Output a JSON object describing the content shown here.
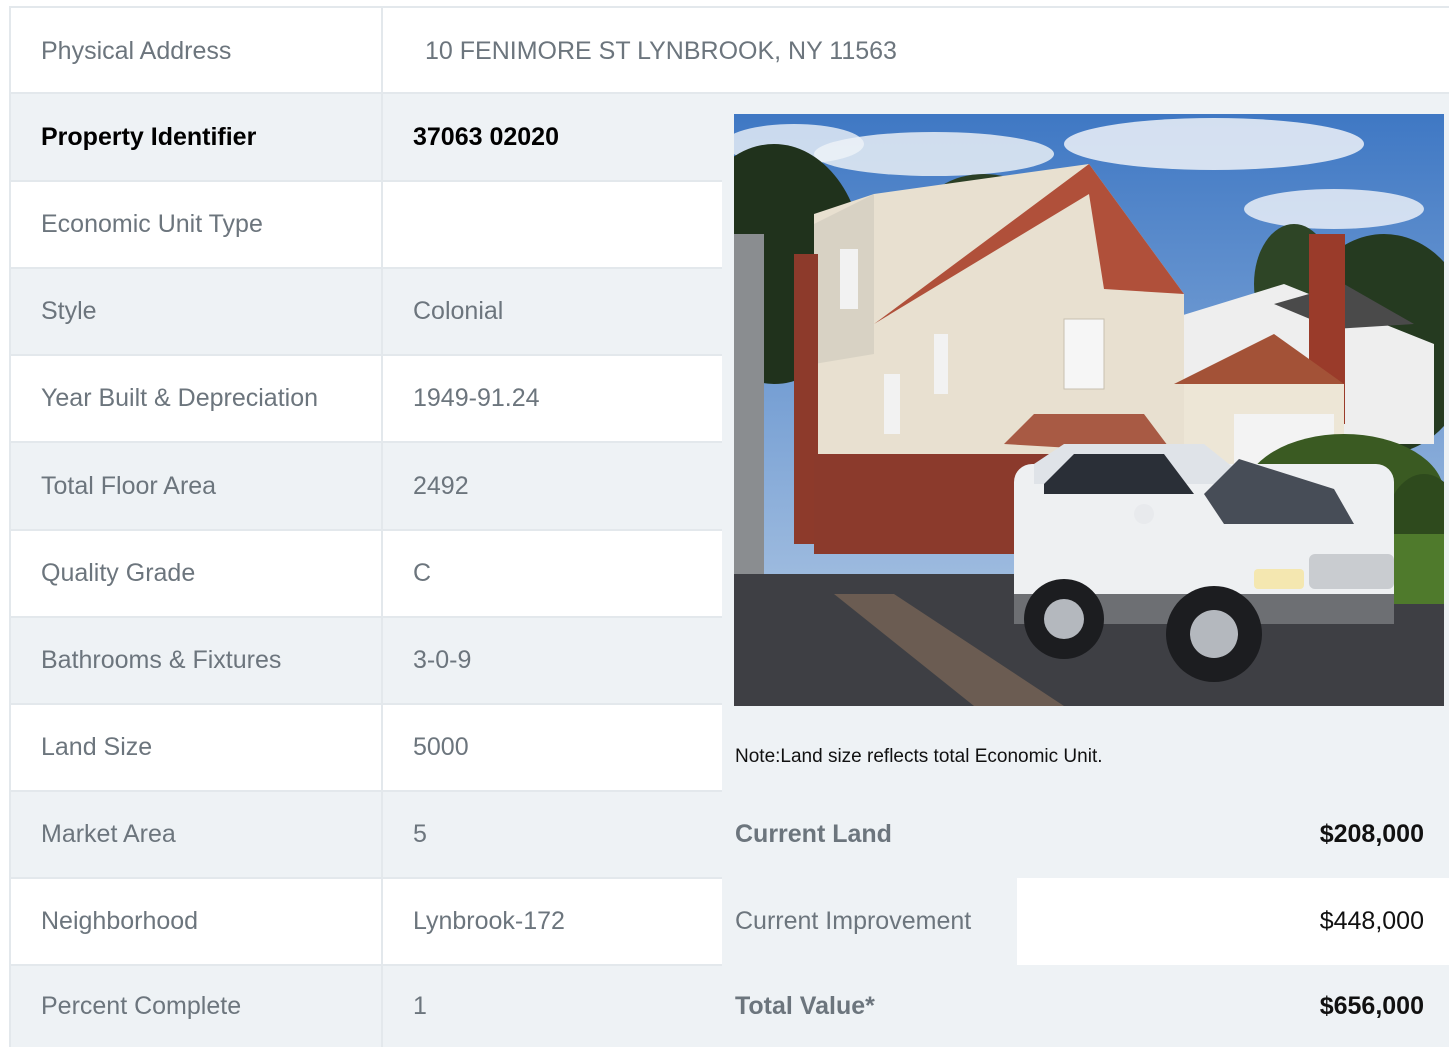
{
  "address": {
    "label": "Physical Address",
    "value": "10  FENIMORE ST  LYNBROOK, NY  11563"
  },
  "rows": [
    {
      "label": "Property Identifier",
      "value": "37063  02020"
    },
    {
      "label": "Economic Unit Type",
      "value": ""
    },
    {
      "label": "Style",
      "value": "Colonial"
    },
    {
      "label": "Year Built & Depreciation",
      "value": "1949-91.24"
    },
    {
      "label": "Total Floor Area",
      "value": "2492"
    },
    {
      "label": "Quality Grade",
      "value": "C"
    },
    {
      "label": "Bathrooms & Fixtures",
      "value": "3-0-9"
    },
    {
      "label": "Land Size",
      "value": "5000"
    },
    {
      "label": "Market Area",
      "value": "5"
    },
    {
      "label": "Neighborhood",
      "value": "Lynbrook-172"
    },
    {
      "label": "Percent Complete",
      "value": "1"
    }
  ],
  "note": "Note:Land size reflects total Economic Unit.",
  "valuation": [
    {
      "label": "Current Land",
      "value": "$208,000"
    },
    {
      "label": "Current Improvement",
      "value": "$448,000"
    },
    {
      "label": "Total Value*",
      "value": "$656,000"
    }
  ]
}
